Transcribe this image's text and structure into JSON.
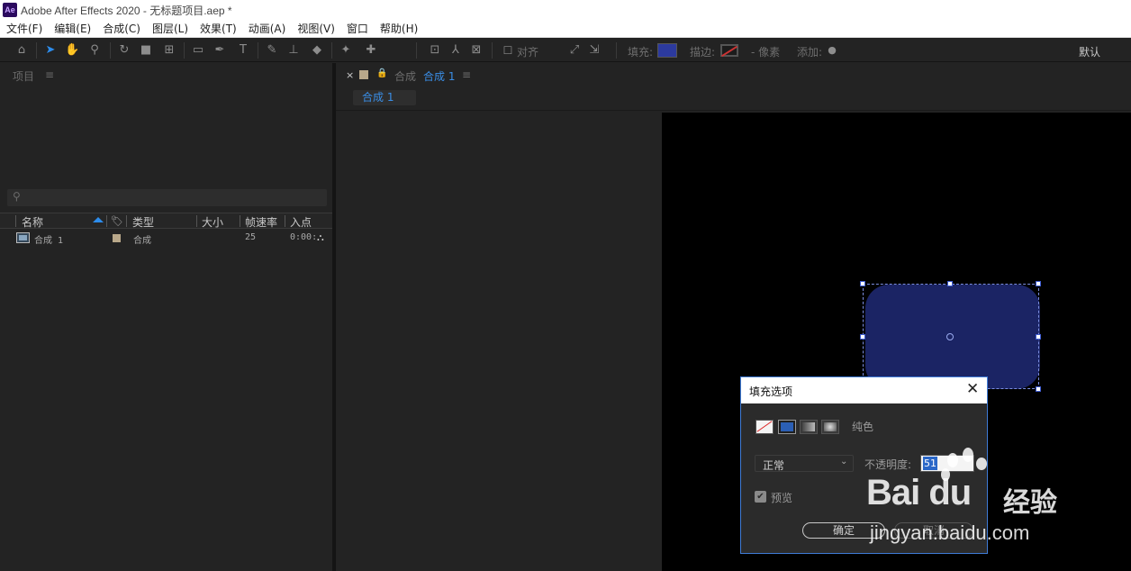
{
  "window": {
    "app_icon": "Ae",
    "title": "Adobe After Effects 2020 - 无标题项目.aep *"
  },
  "menu": [
    "文件(F)",
    "编辑(E)",
    "合成(C)",
    "图层(L)",
    "效果(T)",
    "动画(A)",
    "视图(V)",
    "窗口",
    "帮助(H)"
  ],
  "toolbar": {
    "align_label": "对齐",
    "fill_label": "填充:",
    "stroke_label": "描边:",
    "pixels_label": "- 像素",
    "add_label": "添加:",
    "workspace": "默认",
    "fill_color": "#2c3a9e"
  },
  "project": {
    "title": "项目",
    "menu_glyph": "≡",
    "search_placeholder": "",
    "columns": {
      "name": "名称",
      "type": "类型",
      "size": "大小",
      "fps": "帧速率",
      "in_point": "入点"
    },
    "items": [
      {
        "name": "合成 1",
        "type": "合成",
        "fps": "25",
        "in_point": "0:00:"
      }
    ]
  },
  "composition": {
    "tab_prefix": "合成",
    "tab_name": "合成 1",
    "subtab": "合成 1",
    "menu_glyph": "≡",
    "shape_color": "#1b2464"
  },
  "dialog": {
    "title": "填充选项",
    "fill_type": "纯色",
    "blend_mode": "正常",
    "opacity_label": "不透明度:",
    "opacity_value": "51",
    "preview_label": "预览",
    "preview_checked": true,
    "ok": "确定",
    "cancel": "取消"
  },
  "watermark": {
    "logo": "Bai du",
    "cn": "经验",
    "url": "jingyan.baidu.com"
  }
}
